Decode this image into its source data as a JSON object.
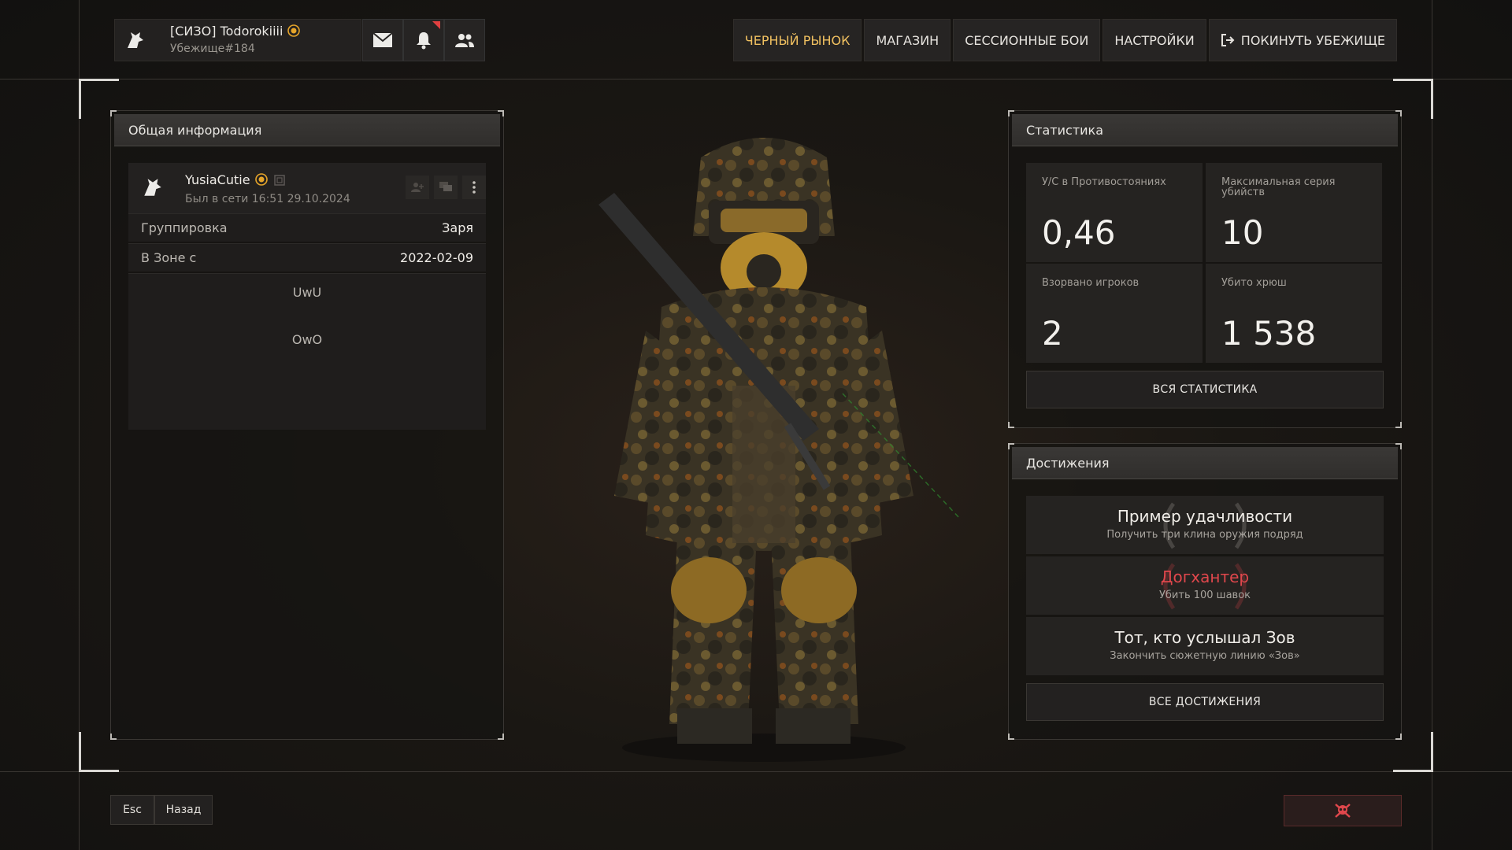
{
  "header": {
    "player_name": "[СИЗО] Todorokiiii",
    "player_subtitle": "Убежище#184",
    "menu": [
      {
        "label": "ЧЕРНЫЙ РЫНОК"
      },
      {
        "label": "МАГАЗИН"
      },
      {
        "label": "СЕССИОННЫЕ БОИ"
      },
      {
        "label": "НАСТРОЙКИ"
      },
      {
        "label": "ПОКИНУТЬ УБЕЖИЩЕ"
      }
    ]
  },
  "general_info": {
    "title": "Общая информация",
    "profile": {
      "name": "YusiaCutie",
      "last_seen": "Был в сети 16:51 29.10.2024"
    },
    "rows": [
      {
        "key": "Группировка",
        "value": "Заря"
      },
      {
        "key": "В Зоне с",
        "value": "2022-02-09"
      }
    ],
    "bio_lines": [
      "UwU",
      "OwO"
    ]
  },
  "stats": {
    "title": "Статистика",
    "cells": [
      {
        "label": "У/С в Противостояниях",
        "value": "0,46"
      },
      {
        "label": "Максимальная серия убийств",
        "value": "10"
      },
      {
        "label": "Взорвано игроков",
        "value": "2"
      },
      {
        "label": "Убито хрюш",
        "value": "1 538"
      }
    ],
    "all_button": "ВСЯ СТАТИСТИКА"
  },
  "achievements": {
    "title": "Достижения",
    "items": [
      {
        "title": "Пример удачливости",
        "desc": "Получить три клина оружия подряд"
      },
      {
        "title": "Догхантер",
        "desc": "Убить 100 шавок"
      },
      {
        "title": "Тот, кто услышал Зов",
        "desc": "Закончить сюжетную линию «Зов»"
      }
    ],
    "all_button": "ВСЕ ДОСТИЖЕНИЯ"
  },
  "footer": {
    "esc_key": "Esc",
    "back_label": "Назад"
  },
  "colors": {
    "accent_gold": "#f0c060",
    "achievement_red": "#e0474c"
  }
}
